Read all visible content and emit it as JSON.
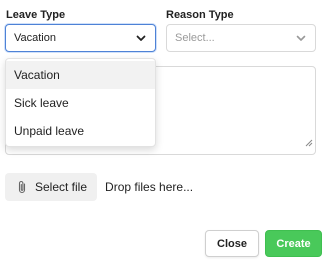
{
  "form": {
    "leave_type_label": "Leave Type",
    "reason_type_label": "Reason Type",
    "leave_type_value": "Vacation",
    "reason_type_placeholder": "Select...",
    "leave_type_options": [
      "Vacation",
      "Sick leave",
      "Unpaid leave"
    ],
    "active_option": "Vacation"
  },
  "upload": {
    "select_label": "Select file",
    "drop_text": "Drop files here...",
    "icon": "paperclip-icon"
  },
  "actions": {
    "close_label": "Close",
    "create_label": "Create"
  },
  "colors": {
    "focus_border": "#4e82d6",
    "create_bg": "#49c95a"
  }
}
